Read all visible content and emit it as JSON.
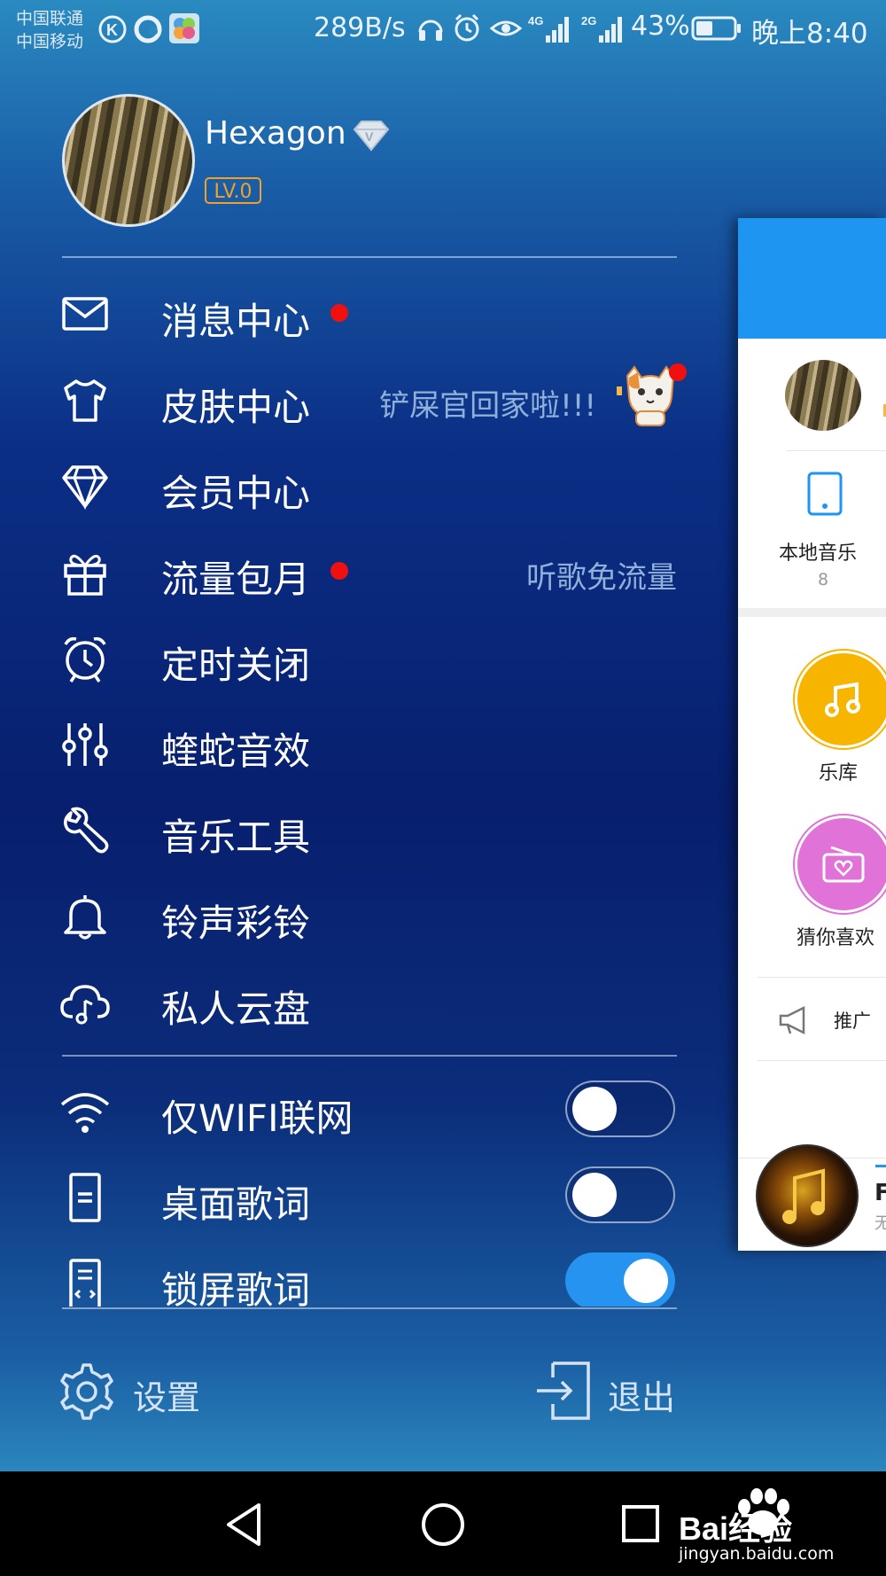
{
  "status_bar": {
    "carrier_1": "中国联通",
    "carrier_2": "中国移动",
    "net_speed": "289B/s",
    "net_4g": "4G",
    "net_2g": "2G",
    "battery": "43%",
    "time": "晚上8:40"
  },
  "profile": {
    "username": "Hexagon",
    "level": "LV.0"
  },
  "menu": {
    "items": [
      {
        "label": "消息中心",
        "icon": "mail-icon",
        "has_dot": true
      },
      {
        "label": "皮肤中心",
        "icon": "shirt-icon",
        "hint": "铲屎官回家啦!!!",
        "has_dot": true
      },
      {
        "label": "会员中心",
        "icon": "diamond-icon"
      },
      {
        "label": "流量包月",
        "icon": "gift-icon",
        "hint": "听歌免流量",
        "has_dot": true
      },
      {
        "label": "定时关闭",
        "icon": "alarm-clock-icon"
      },
      {
        "label": "蝰蛇音效",
        "icon": "equalizer-icon"
      },
      {
        "label": "音乐工具",
        "icon": "wrench-icon"
      },
      {
        "label": "铃声彩铃",
        "icon": "bell-icon"
      },
      {
        "label": "私人云盘",
        "icon": "cloud-music-icon"
      }
    ]
  },
  "settings": {
    "wifi_only": {
      "label": "仅WIFI联网",
      "icon": "wifi-icon",
      "on": false
    },
    "desktop_lyrics": {
      "label": "桌面歌词",
      "icon": "document-icon",
      "on": false
    },
    "lock_lyrics": {
      "label": "锁屏歌词",
      "icon": "lock-lyrics-icon",
      "on": true
    }
  },
  "bottom": {
    "settings_label": "设置",
    "logout_label": "退出"
  },
  "right_panel": {
    "local_music_label": "本地音乐",
    "local_music_count": "8",
    "library_label": "乐库",
    "guess_label": "猜你喜欢",
    "promo_label": "推广",
    "player_title_fragment": "F",
    "player_sub_fragment": "无"
  },
  "watermark": {
    "brand": "Bai经验",
    "url": "jingyan.baidu.com"
  },
  "colors": {
    "accent_blue": "#1e95f0",
    "toggle_on": "#2693f0",
    "level_badge": "#f0a12a",
    "red_dot": "#f01010",
    "library_yellow": "#f7b500",
    "guess_pink": "#e072d8"
  }
}
